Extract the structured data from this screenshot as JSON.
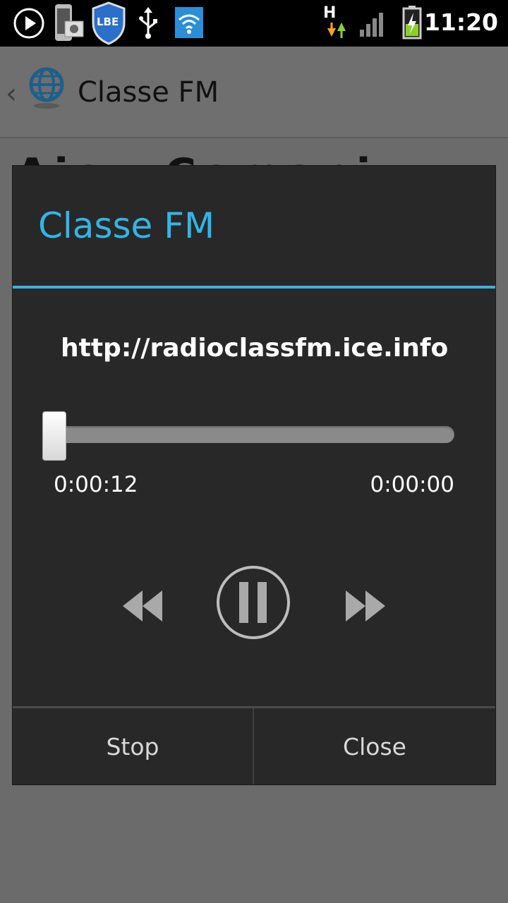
{
  "status_bar": {
    "time": "11:20",
    "icons": [
      "play-icon",
      "phone-photo-icon",
      "lbe-shield-icon",
      "usb-icon",
      "wifi-icon",
      "data-h-icon",
      "signal-icon",
      "battery-icon"
    ],
    "lbe_label": "LBE",
    "network_type": "H"
  },
  "app_bar": {
    "title": "Classe FM"
  },
  "background": {
    "peek_text": "Aiou Comani"
  },
  "dialog": {
    "title": "Classe FM",
    "url": "http://radioclassfm.ice.infomaniak.ch",
    "progress": 0.0,
    "time_elapsed": "0:00:12",
    "time_total": "0:00:00",
    "stop_label": "Stop",
    "close_label": "Close"
  },
  "colors": {
    "accent": "#33b5e5",
    "dialog_bg": "#282828",
    "dim_bg": "#6b6b6b"
  }
}
